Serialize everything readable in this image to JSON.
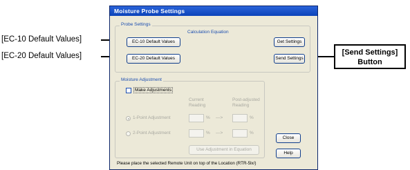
{
  "annotations": {
    "ec10": "[EC-10 Default Values]",
    "ec20": "[EC-20 Default Values]",
    "send_line1": "[Send Settings]",
    "send_line2": "Button"
  },
  "window": {
    "title": "Moisture Probe Settings"
  },
  "probe_settings": {
    "group_label": "Probe Settings",
    "ec10_button": "EC-10 Default Values",
    "ec20_button": "EC-20 Default Values",
    "calc_label": "Calculation Equation",
    "get_settings_button": "Get Settings",
    "send_settings_button": "Send Settings"
  },
  "moisture_adjustment": {
    "group_label": "Moisture Adjustment",
    "make_adjustments": "Make Adjustments",
    "current_reading_1": "Current",
    "current_reading_2": "Reading",
    "post_reading_1": "Post-adjusted",
    "post_reading_2": "Reading",
    "one_point": "1-Point Adjustment",
    "two_point": "2-Point Adjustment",
    "unit_1": "%",
    "unit_2": "%",
    "unit_3": "%",
    "unit_4": "%",
    "arrow_1": "—>",
    "arrow_2": "—>",
    "use_adjustment_button": "Use Adjustment in Equation"
  },
  "buttons": {
    "close": "Close",
    "help": "Help"
  },
  "status_text": "Please place the selected Remote Unit on top of the Location (RTR-5lx/)"
}
